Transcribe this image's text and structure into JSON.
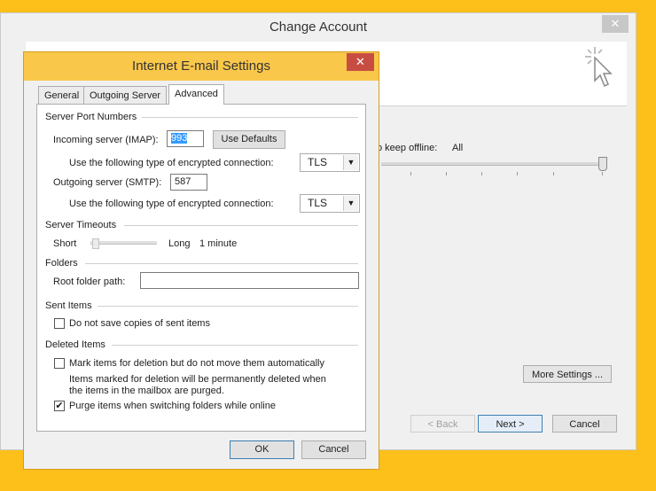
{
  "background_window": {
    "title": "Change Account",
    "close_label": "✕",
    "offline_label": "o keep offline:",
    "offline_value": "All",
    "more_settings_label": "More Settings ...",
    "back_label": "< Back",
    "next_label": "Next >",
    "cancel_label": "Cancel"
  },
  "dialog": {
    "title": "Internet E-mail Settings",
    "close_label": "✕",
    "tabs": [
      {
        "label": "General",
        "active": false
      },
      {
        "label": "Outgoing Server",
        "active": false
      },
      {
        "label": "Advanced",
        "active": true
      }
    ],
    "server_ports": {
      "heading": "Server Port Numbers",
      "incoming_label": "Incoming server (IMAP):",
      "incoming_value": "993",
      "use_defaults_label": "Use Defaults",
      "incoming_enc_label": "Use the following type of encrypted connection:",
      "incoming_enc_value": "TLS",
      "outgoing_label": "Outgoing server (SMTP):",
      "outgoing_value": "587",
      "outgoing_enc_label": "Use the following type of encrypted connection:",
      "outgoing_enc_value": "TLS"
    },
    "timeouts": {
      "heading": "Server Timeouts",
      "short_label": "Short",
      "long_label": "Long",
      "value": "1 minute",
      "level": 0.05
    },
    "folders": {
      "heading": "Folders",
      "root_label": "Root folder path:",
      "root_value": ""
    },
    "sent_items": {
      "heading": "Sent Items",
      "no_copies_label": "Do not save copies of sent items",
      "no_copies_checked": false
    },
    "deleted_items": {
      "heading": "Deleted Items",
      "mark_label": "Mark items for deletion but do not move them automatically",
      "mark_checked": false,
      "note_line1": "Items marked for deletion will be permanently deleted when",
      "note_line2": "the items in the mailbox are purged.",
      "purge_label": "Purge items when switching folders while online",
      "purge_checked": true
    },
    "ok_label": "OK",
    "cancel_label": "Cancel"
  },
  "colors": {
    "desktop": "#fdbf19",
    "dialog_titlebar": "#f9c74a",
    "close_button": "#c74d43",
    "selection": "#3399ff"
  }
}
